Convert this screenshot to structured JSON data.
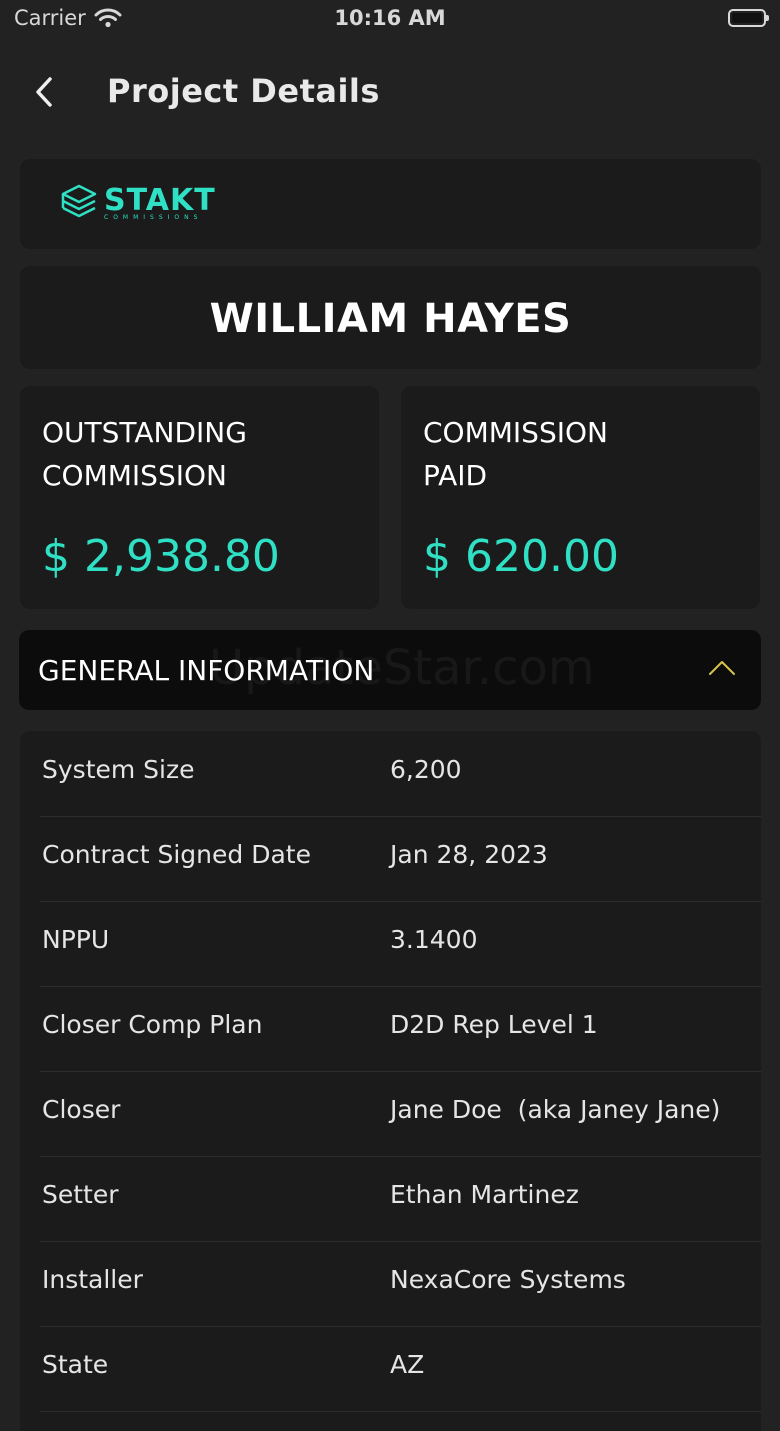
{
  "status_bar": {
    "carrier": "Carrier",
    "time": "10:16 AM"
  },
  "nav": {
    "title": "Project Details"
  },
  "logo": {
    "brand": "STAKT",
    "tagline": "COMMISSIONS"
  },
  "customer": {
    "name": "WILLIAM HAYES"
  },
  "stats": {
    "outstanding": {
      "label_line1": "OUTSTANDING",
      "label_line2": "COMMISSION",
      "value": "$ 2,938.80"
    },
    "paid": {
      "label_line1": "COMMISSION",
      "label_line2": "PAID",
      "value": "$ 620.00"
    }
  },
  "general_info": {
    "title": "GENERAL INFORMATION",
    "rows": [
      {
        "label": "System Size",
        "value": "6,200"
      },
      {
        "label": "Contract Signed Date",
        "value": "Jan 28, 2023"
      },
      {
        "label": "NPPU",
        "value": "3.1400"
      },
      {
        "label": "Closer Comp Plan",
        "value": "D2D Rep Level 1"
      },
      {
        "label": "Closer",
        "value": "Jane Doe  (aka Janey Jane)"
      },
      {
        "label": "Setter",
        "value": "Ethan Martinez"
      },
      {
        "label": "Installer",
        "value": "NexaCore Systems"
      },
      {
        "label": "State",
        "value": "AZ"
      }
    ]
  },
  "watermark": "UpdateStar.com",
  "colors": {
    "background": "#222222",
    "card": "#1b1b1b",
    "header": "#0c0c0c",
    "accent": "#2fe0c4",
    "chevron": "#d8c44a"
  },
  "icons": {
    "back": "chevron-left-icon",
    "section_toggle": "chevron-up-icon",
    "wifi": "wifi-icon",
    "battery": "battery-icon",
    "logo": "stack-logo-icon"
  }
}
